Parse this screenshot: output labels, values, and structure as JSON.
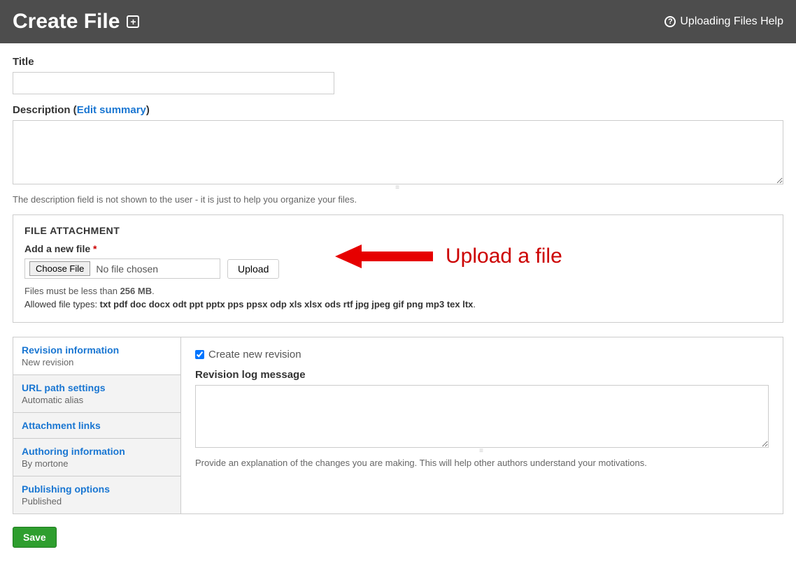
{
  "header": {
    "title": "Create File",
    "help_label": "Uploading Files Help"
  },
  "form": {
    "title_label": "Title",
    "title_value": "",
    "description_label_prefix": "Description (",
    "description_edit_summary": "Edit summary",
    "description_label_suffix": ")",
    "description_value": "",
    "description_help": "The description field is not shown to the user - it is just to help you organize your files."
  },
  "attachment": {
    "legend": "FILE ATTACHMENT",
    "add_file_label": "Add a new file",
    "required_mark": "*",
    "choose_file_label": "Choose File",
    "no_file_text": "No file chosen",
    "upload_label": "Upload",
    "size_help_prefix": "Files must be less than ",
    "size_limit": "256 MB",
    "size_help_suffix": ".",
    "types_prefix": "Allowed file types: ",
    "types_list": "txt pdf doc docx odt ppt pptx pps ppsx odp xls xlsx ods rtf jpg jpeg gif png mp3 tex ltx",
    "types_suffix": "."
  },
  "annotation": {
    "text": "Upload a file"
  },
  "vertical_tabs": [
    {
      "title": "Revision information",
      "sub": "New revision"
    },
    {
      "title": "URL path settings",
      "sub": "Automatic alias"
    },
    {
      "title": "Attachment links",
      "sub": ""
    },
    {
      "title": "Authoring information",
      "sub": "By mortone"
    },
    {
      "title": "Publishing options",
      "sub": "Published"
    }
  ],
  "revision_panel": {
    "checkbox_label": "Create new revision",
    "checkbox_checked": true,
    "log_label": "Revision log message",
    "log_value": "",
    "log_help": "Provide an explanation of the changes you are making. This will help other authors understand your motivations."
  },
  "actions": {
    "save_label": "Save"
  }
}
